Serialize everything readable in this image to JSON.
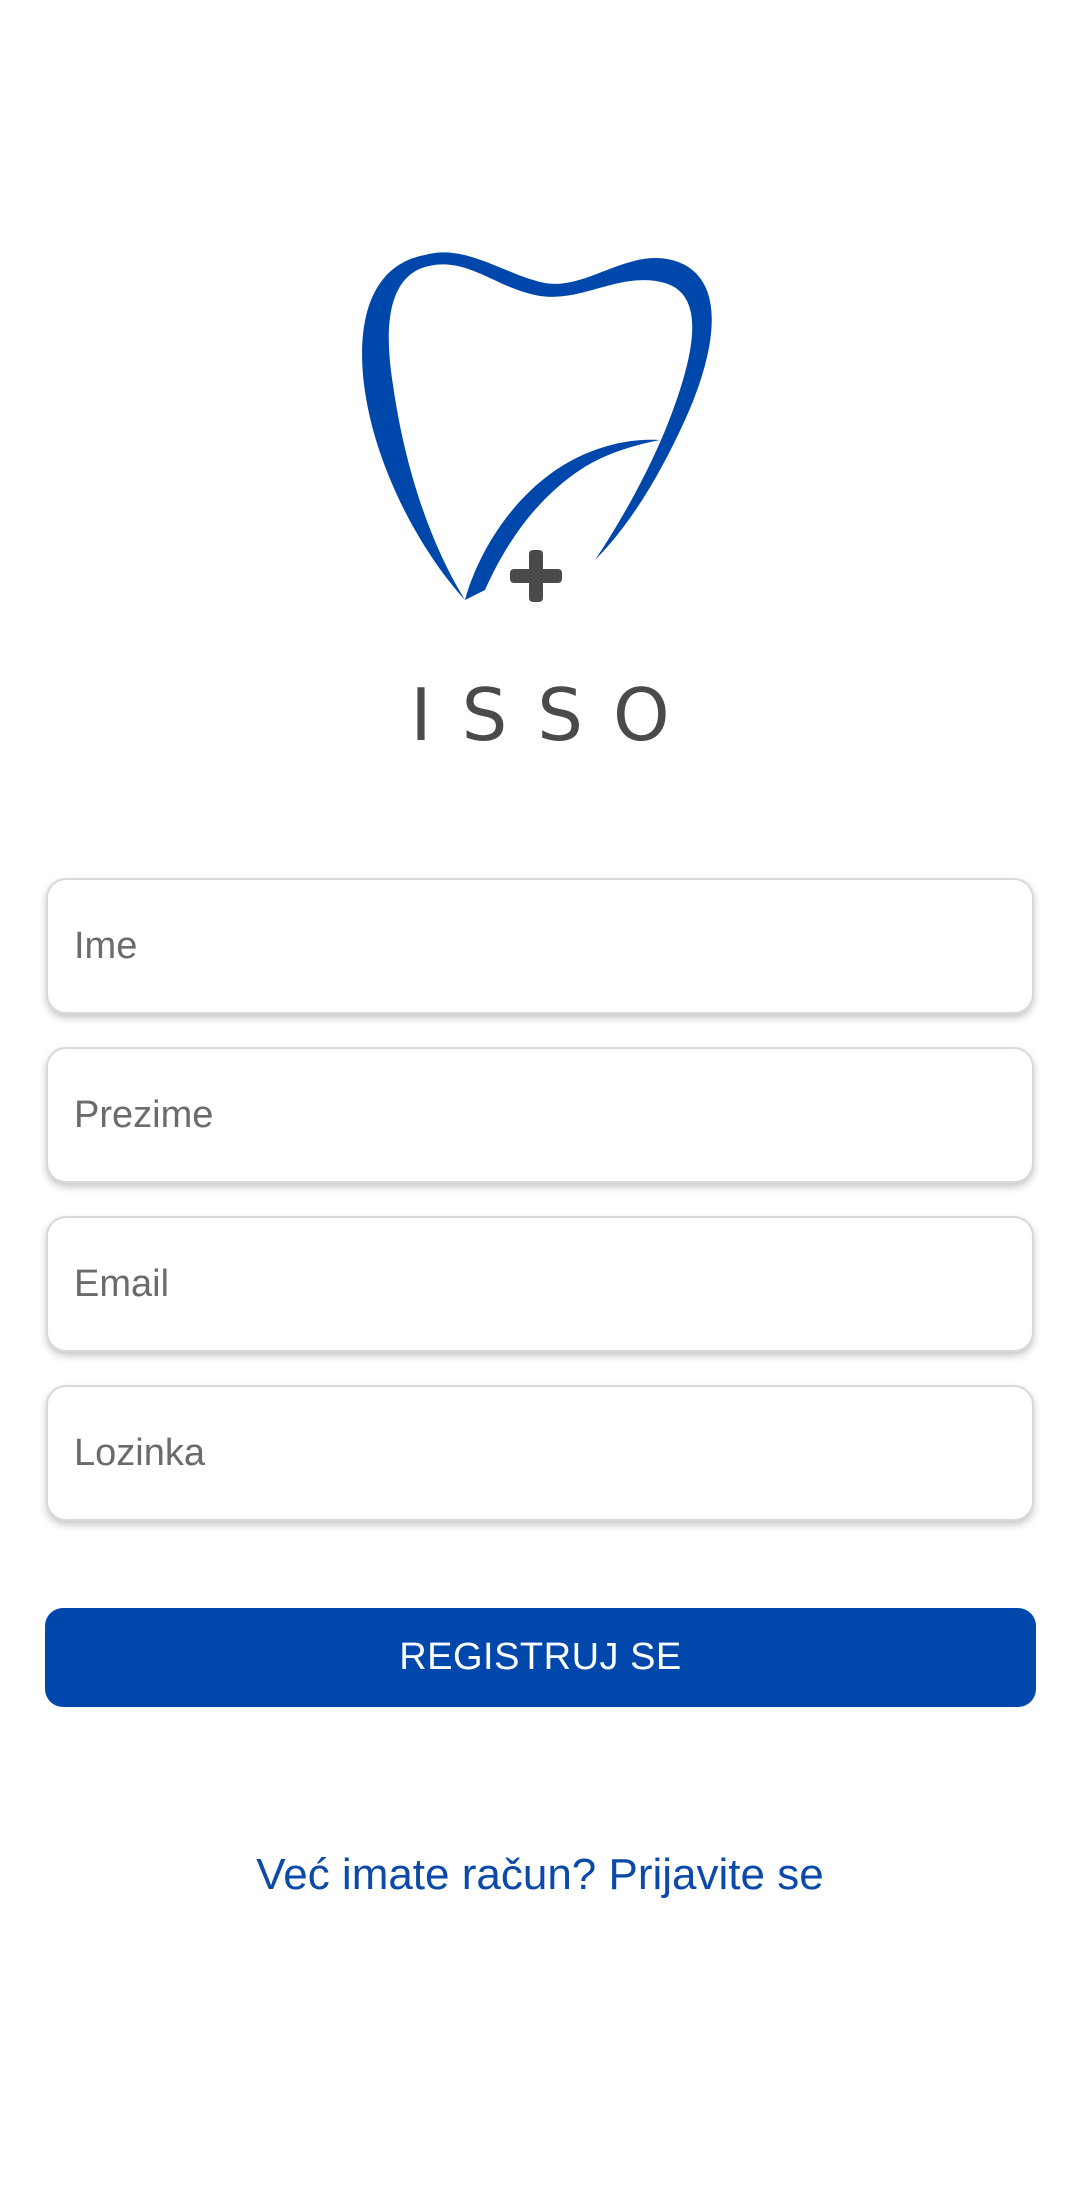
{
  "brand": {
    "logo_icon": "tooth-with-plus-icon",
    "name": "ISSO",
    "accent_color": "#0047ab",
    "mark_color": "#4a4a4a"
  },
  "form": {
    "first_name_placeholder": "Ime",
    "last_name_placeholder": "Prezime",
    "email_placeholder": "Email",
    "password_placeholder": "Lozinka"
  },
  "actions": {
    "register_label": "REGISTRUJ SE",
    "login_link": "Već imate račun? Prijavite se"
  }
}
